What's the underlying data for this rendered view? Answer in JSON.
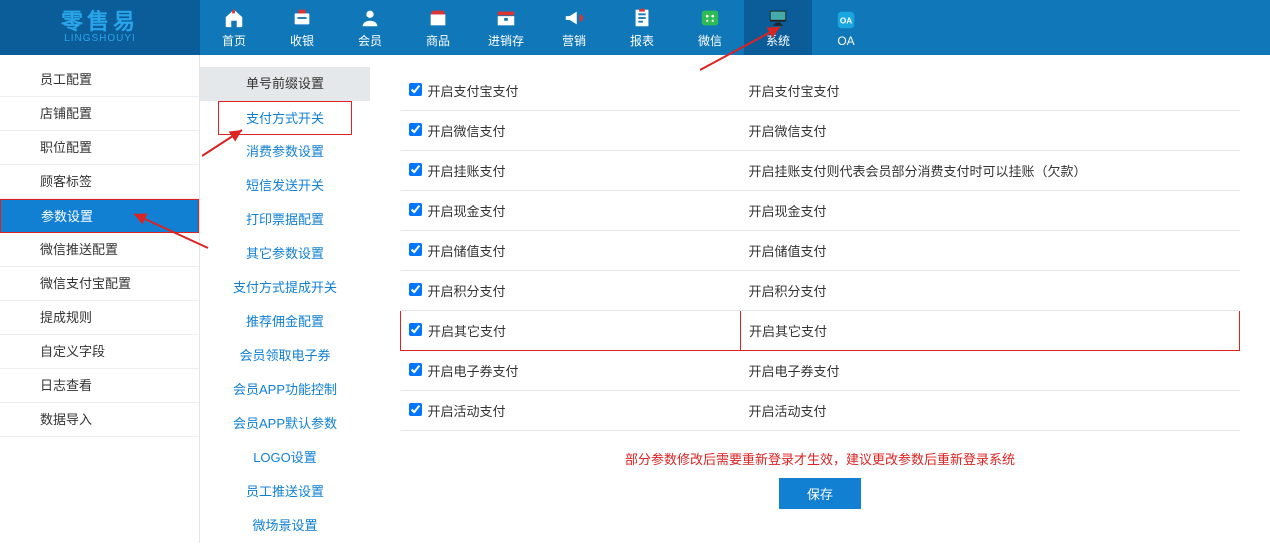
{
  "logo": {
    "cn": "零售易",
    "en": "LINGSHOUYI"
  },
  "topnav": [
    {
      "label": "首页",
      "icon": "home"
    },
    {
      "label": "收银",
      "icon": "cash"
    },
    {
      "label": "会员",
      "icon": "member"
    },
    {
      "label": "商品",
      "icon": "goods"
    },
    {
      "label": "进销存",
      "icon": "stock"
    },
    {
      "label": "营销",
      "icon": "marketing"
    },
    {
      "label": "报表",
      "icon": "report"
    },
    {
      "label": "微信",
      "icon": "wechat"
    },
    {
      "label": "系统",
      "icon": "system",
      "active": true
    },
    {
      "label": "OA",
      "icon": "oa"
    }
  ],
  "leftnav": [
    {
      "label": "员工配置"
    },
    {
      "label": "店铺配置"
    },
    {
      "label": "职位配置"
    },
    {
      "label": "顾客标签"
    },
    {
      "label": "参数设置",
      "active": true
    },
    {
      "label": "微信推送配置"
    },
    {
      "label": "微信支付宝配置"
    },
    {
      "label": "提成规则"
    },
    {
      "label": "自定义字段"
    },
    {
      "label": "日志查看"
    },
    {
      "label": "数据导入"
    }
  ],
  "subnav": [
    {
      "label": "单号前缀设置",
      "top": true
    },
    {
      "label": "支付方式开关",
      "active": true
    },
    {
      "label": "消费参数设置"
    },
    {
      "label": "短信发送开关"
    },
    {
      "label": "打印票据配置"
    },
    {
      "label": "其它参数设置"
    },
    {
      "label": "支付方式提成开关"
    },
    {
      "label": "推荐佣金配置"
    },
    {
      "label": "会员领取电子券"
    },
    {
      "label": "会员APP功能控制"
    },
    {
      "label": "会员APP默认参数"
    },
    {
      "label": "LOGO设置"
    },
    {
      "label": "员工推送设置"
    },
    {
      "label": "微场景设置"
    }
  ],
  "rows": [
    {
      "left": "开启支付宝支付",
      "right": "开启支付宝支付"
    },
    {
      "left": "开启微信支付",
      "right": "开启微信支付"
    },
    {
      "left": "开启挂账支付",
      "right": "开启挂账支付则代表会员部分消费支付时可以挂账（欠款）"
    },
    {
      "left": "开启现金支付",
      "right": "开启现金支付"
    },
    {
      "left": "开启储值支付",
      "right": "开启储值支付"
    },
    {
      "left": "开启积分支付",
      "right": "开启积分支付"
    },
    {
      "left": "开启其它支付",
      "right": "开启其它支付",
      "highlight": true
    },
    {
      "left": "开启电子券支付",
      "right": "开启电子券支付"
    },
    {
      "left": "开启活动支付",
      "right": "开启活动支付"
    }
  ],
  "warning_text": "部分参数修改后需要重新登录才生效，建议更改参数后重新登录系统",
  "save_label": "保存",
  "colors": {
    "primary": "#1180d3",
    "topbar": "#1077b9",
    "highlight_border": "#d22"
  }
}
